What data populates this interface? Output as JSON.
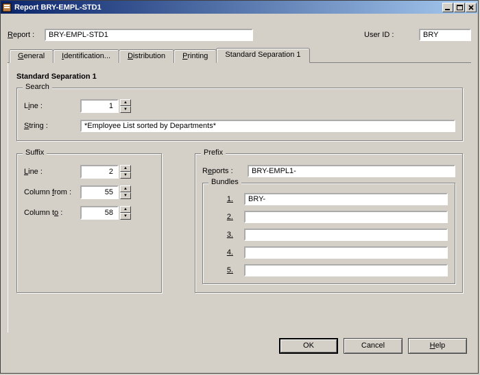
{
  "window": {
    "title": "Report BRY-EMPL-STD1"
  },
  "header": {
    "report_label": "Report :",
    "report_value": "BRY-EMPL-STD1",
    "userid_label": "User ID :",
    "userid_value": "BRY"
  },
  "tabs": {
    "general": "General",
    "identification": "Identification...",
    "distribution": "Distribution",
    "printing": "Printing",
    "standard_sep": "Standard Separation 1"
  },
  "panel": {
    "title": "Standard Separation 1",
    "search": {
      "legend": "Search",
      "line_label": "Line :",
      "line_value": "1",
      "string_label": "String :",
      "string_value": "*Employee List sorted by Departments*"
    },
    "suffix": {
      "legend": "Suffix",
      "line_label": "Line :",
      "line_value": "2",
      "colfrom_label": "Column from :",
      "colfrom_value": "55",
      "colto_label": "Column to :",
      "colto_value": "58"
    },
    "prefix": {
      "legend": "Prefix",
      "reports_label": "Reports :",
      "reports_value": "BRY-EMPL1-",
      "bundles_legend": "Bundles",
      "bundles": [
        {
          "label": "1.",
          "value": "BRY-"
        },
        {
          "label": "2.",
          "value": ""
        },
        {
          "label": "3.",
          "value": ""
        },
        {
          "label": "4.",
          "value": ""
        },
        {
          "label": "5.",
          "value": ""
        }
      ]
    }
  },
  "buttons": {
    "ok": "OK",
    "cancel": "Cancel",
    "help": "Help"
  }
}
